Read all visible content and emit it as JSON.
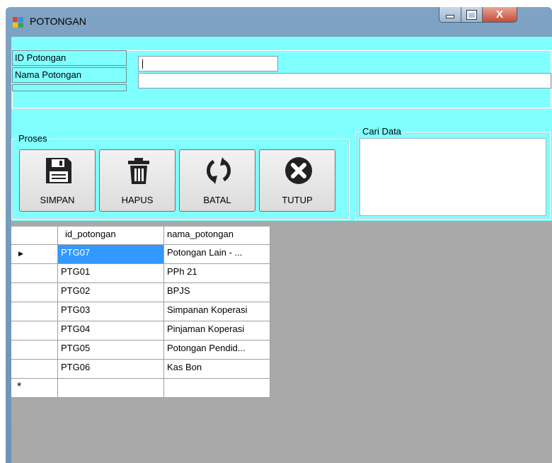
{
  "window": {
    "title": "POTONGAN",
    "controls": {
      "close": "X"
    }
  },
  "form": {
    "id_label": "ID Potongan",
    "id_value": "",
    "nama_label": "Nama Potongan",
    "nama_value": ""
  },
  "proses": {
    "legend": "Proses",
    "buttons": [
      {
        "label": "SIMPAN",
        "icon": "floppy-disk-icon"
      },
      {
        "label": "HAPUS",
        "icon": "trash-icon"
      },
      {
        "label": "BATAL",
        "icon": "refresh-icon"
      },
      {
        "label": "TUTUP",
        "icon": "close-circle-icon"
      }
    ]
  },
  "cari": {
    "legend": "Cari Data"
  },
  "grid": {
    "columns": [
      "id_potongan",
      "nama_potongan"
    ],
    "rows": [
      [
        "PTG07",
        "Potongan Lain - ..."
      ],
      [
        "PTG01",
        "PPh 21"
      ],
      [
        "PTG02",
        "BPJS"
      ],
      [
        "PTG03",
        "Simpanan Koperasi"
      ],
      [
        "PTG04",
        "Pinjaman Koperasi"
      ],
      [
        "PTG05",
        "Potongan Pendid..."
      ],
      [
        "PTG06",
        "Kas Bon"
      ]
    ],
    "new_row_marker": "*",
    "current_row_marker": "▶",
    "selected_color": "#3399ff"
  },
  "colors": {
    "panel": "#80ffff",
    "grid_background": "#a9a9a9"
  }
}
